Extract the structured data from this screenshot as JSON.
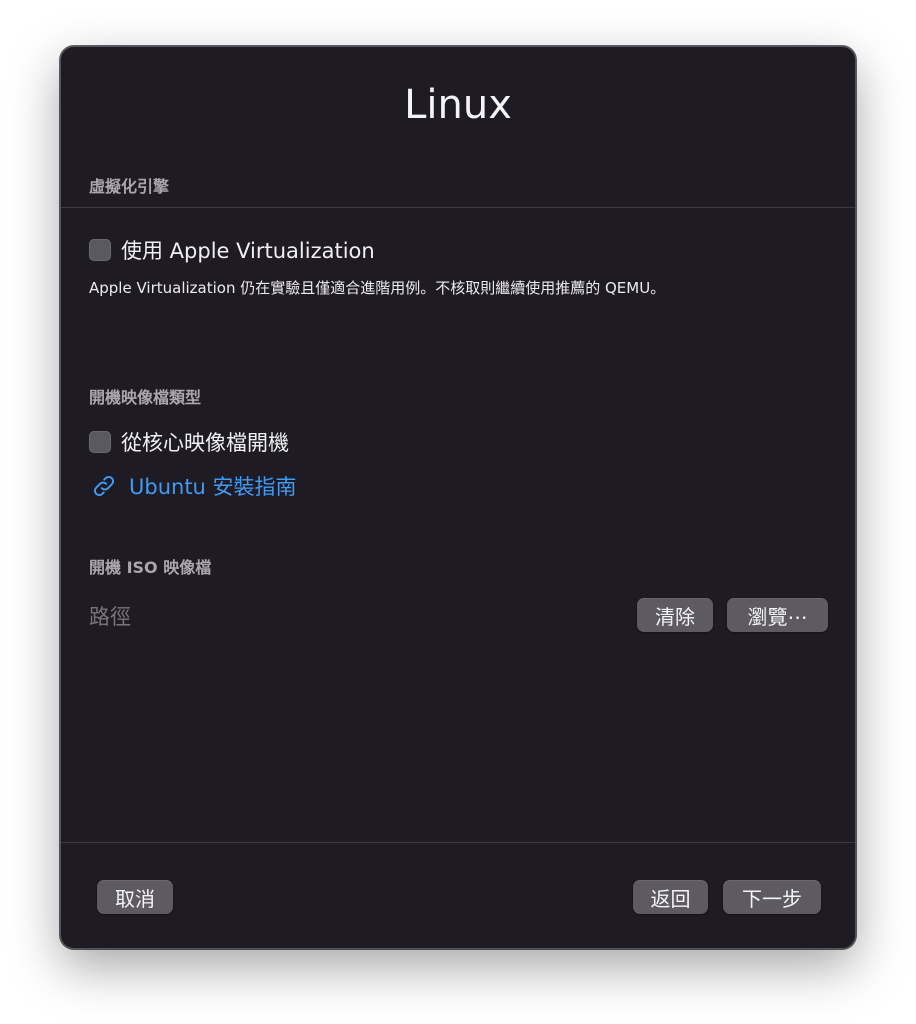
{
  "window": {
    "title": "Linux"
  },
  "virtualization": {
    "section_label": "虛擬化引擎",
    "apple_virtualization_label": "使用 Apple Virtualization",
    "apple_virtualization_checked": false,
    "note": "Apple Virtualization 仍在實驗且僅適合進階用例。不核取則繼續使用推薦的 QEMU。"
  },
  "boot_image_type": {
    "section_label": "開機映像檔類型",
    "kernel_boot_label": "從核心映像檔開機",
    "kernel_boot_checked": false,
    "guide_link": "Ubuntu 安裝指南"
  },
  "boot_iso": {
    "section_label": "開機 ISO 映像檔",
    "path_placeholder": "路徑",
    "clear_label": "清除",
    "browse_label": "瀏覽⋯"
  },
  "footer": {
    "cancel_label": "取消",
    "back_label": "返回",
    "next_label": "下一步"
  },
  "colors": {
    "window_bg": "#1e1b24",
    "link": "#3f9bf5",
    "button_bg": "#5d5a62"
  }
}
